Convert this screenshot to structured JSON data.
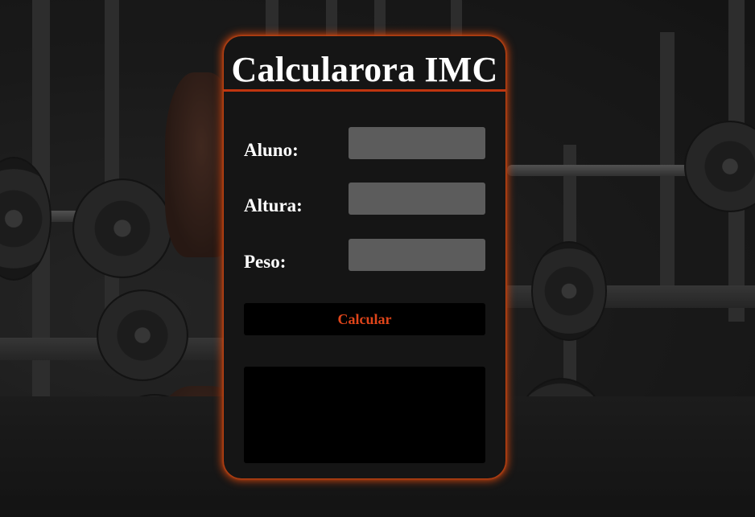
{
  "app": {
    "title": "Calcularora IMC"
  },
  "form": {
    "aluno": {
      "label": "Aluno:",
      "value": ""
    },
    "altura": {
      "label": "Altura:",
      "value": ""
    },
    "peso": {
      "label": "Peso:",
      "value": ""
    }
  },
  "actions": {
    "calculate_label": "Calcular"
  },
  "result": {
    "text": ""
  },
  "colors": {
    "accent": "#c2410e",
    "button_text": "#e0451a",
    "card_bg": "#151515",
    "input_bg": "#5c5c5c"
  }
}
